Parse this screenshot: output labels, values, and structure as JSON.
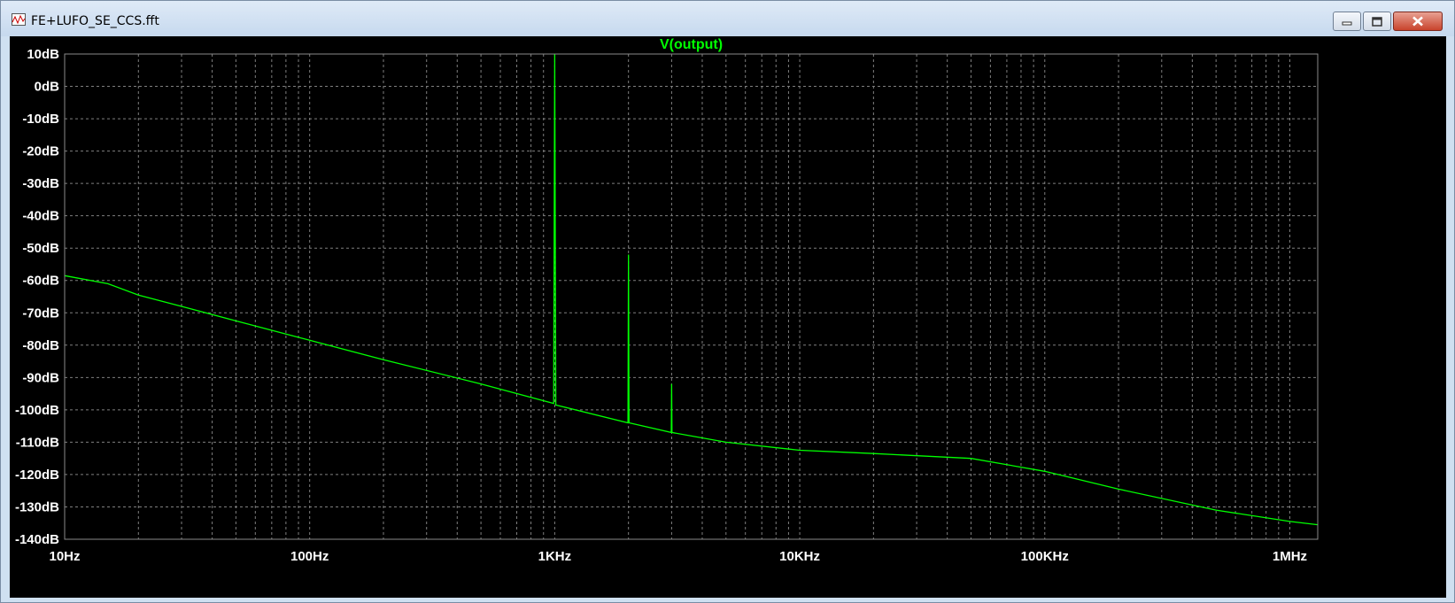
{
  "window": {
    "title": "FE+LUFO_SE_CCS.fft"
  },
  "icons": {
    "app": "waveform-icon",
    "minimize": "minimize-icon",
    "maximize": "maximize-icon",
    "close": "close-icon"
  },
  "colors": {
    "background": "#000000",
    "trace": "#00ff00",
    "grid": "#7f7f7f",
    "text": "#ffffff"
  },
  "chart_data": {
    "type": "line",
    "title": "V(output)",
    "xlabel": "",
    "ylabel": "",
    "xscale": "log",
    "xlim": [
      10,
      1300000
    ],
    "ylim": [
      -140,
      10
    ],
    "grid": true,
    "x_ticks": [
      10,
      100,
      1000,
      10000,
      100000,
      1000000
    ],
    "x_tick_labels": [
      "10Hz",
      "100Hz",
      "1KHz",
      "10KHz",
      "100KHz",
      "1MHz"
    ],
    "y_ticks": [
      10,
      0,
      -10,
      -20,
      -30,
      -40,
      -50,
      -60,
      -70,
      -80,
      -90,
      -100,
      -110,
      -120,
      -130,
      -140
    ],
    "y_tick_labels": [
      "10dB",
      "0dB",
      "-10dB",
      "-20dB",
      "-30dB",
      "-40dB",
      "-50dB",
      "-60dB",
      "-70dB",
      "-80dB",
      "-90dB",
      "-100dB",
      "-110dB",
      "-120dB",
      "-130dB",
      "-140dB"
    ],
    "series": [
      {
        "name": "V(output)",
        "color": "#00ff00",
        "x": [
          10,
          15,
          20,
          30,
          50,
          100,
          200,
          500,
          990,
          1000,
          1010,
          1990,
          2000,
          2010,
          2990,
          3000,
          3010,
          5000,
          10000,
          20000,
          50000,
          100000,
          200000,
          500000,
          1000000,
          1300000
        ],
        "y": [
          -58.5,
          -61,
          -64.5,
          -68,
          -72.5,
          -78.5,
          -84.5,
          -92,
          -98,
          10,
          -98.5,
          -104,
          -52,
          -104,
          -107,
          -92,
          -107,
          -110,
          -112.5,
          -113.5,
          -115,
          -119,
          -124.5,
          -131,
          -134.5,
          -135.5
        ]
      }
    ]
  }
}
